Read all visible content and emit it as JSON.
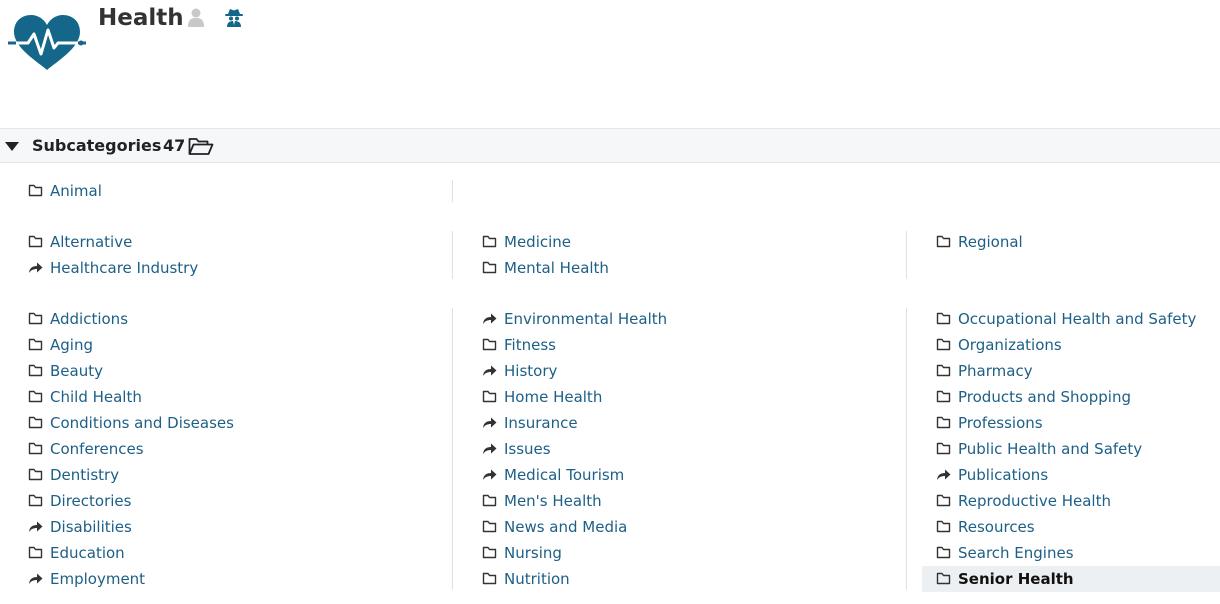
{
  "header": {
    "title": "Health",
    "user_icon": "user-icon",
    "editor_icon": "spy-icon",
    "logo": "heart-pulse-logo",
    "colors": {
      "brand": "#14678a",
      "link": "#1d5f86"
    }
  },
  "subcategories_bar": {
    "label": "Subcategories",
    "count": "47",
    "toggle_icon": "caret-down-icon",
    "folder_icon": "folder-open-icon"
  },
  "groups": [
    {
      "columns": [
        [
          {
            "label": "Animal",
            "icon": "folder"
          }
        ]
      ]
    },
    {
      "columns": [
        [
          {
            "label": "Alternative",
            "icon": "folder"
          },
          {
            "label": "Healthcare Industry",
            "icon": "link"
          }
        ],
        [
          {
            "label": "Medicine",
            "icon": "folder"
          },
          {
            "label": "Mental Health",
            "icon": "folder"
          }
        ],
        [
          {
            "label": "Regional",
            "icon": "folder"
          }
        ]
      ]
    },
    {
      "columns": [
        [
          {
            "label": "Addictions",
            "icon": "folder"
          },
          {
            "label": "Aging",
            "icon": "folder"
          },
          {
            "label": "Beauty",
            "icon": "folder"
          },
          {
            "label": "Child Health",
            "icon": "folder"
          },
          {
            "label": "Conditions and Diseases",
            "icon": "folder"
          },
          {
            "label": "Conferences",
            "icon": "folder"
          },
          {
            "label": "Dentistry",
            "icon": "folder"
          },
          {
            "label": "Directories",
            "icon": "folder"
          },
          {
            "label": "Disabilities",
            "icon": "link"
          },
          {
            "label": "Education",
            "icon": "folder"
          },
          {
            "label": "Employment",
            "icon": "link"
          }
        ],
        [
          {
            "label": "Environmental Health",
            "icon": "link"
          },
          {
            "label": "Fitness",
            "icon": "folder"
          },
          {
            "label": "History",
            "icon": "link"
          },
          {
            "label": "Home Health",
            "icon": "folder"
          },
          {
            "label": "Insurance",
            "icon": "link"
          },
          {
            "label": "Issues",
            "icon": "link"
          },
          {
            "label": "Medical Tourism",
            "icon": "link"
          },
          {
            "label": "Men's Health",
            "icon": "folder"
          },
          {
            "label": "News and Media",
            "icon": "folder"
          },
          {
            "label": "Nursing",
            "icon": "folder"
          },
          {
            "label": "Nutrition",
            "icon": "folder"
          }
        ],
        [
          {
            "label": "Occupational Health and Safety",
            "icon": "folder"
          },
          {
            "label": "Organizations",
            "icon": "folder"
          },
          {
            "label": "Pharmacy",
            "icon": "folder"
          },
          {
            "label": "Products and Shopping",
            "icon": "folder"
          },
          {
            "label": "Professions",
            "icon": "folder"
          },
          {
            "label": "Public Health and Safety",
            "icon": "folder"
          },
          {
            "label": "Publications",
            "icon": "link"
          },
          {
            "label": "Reproductive Health",
            "icon": "folder"
          },
          {
            "label": "Resources",
            "icon": "folder"
          },
          {
            "label": "Search Engines",
            "icon": "folder"
          },
          {
            "label": "Senior Health",
            "icon": "folder",
            "current": true
          }
        ]
      ]
    }
  ]
}
